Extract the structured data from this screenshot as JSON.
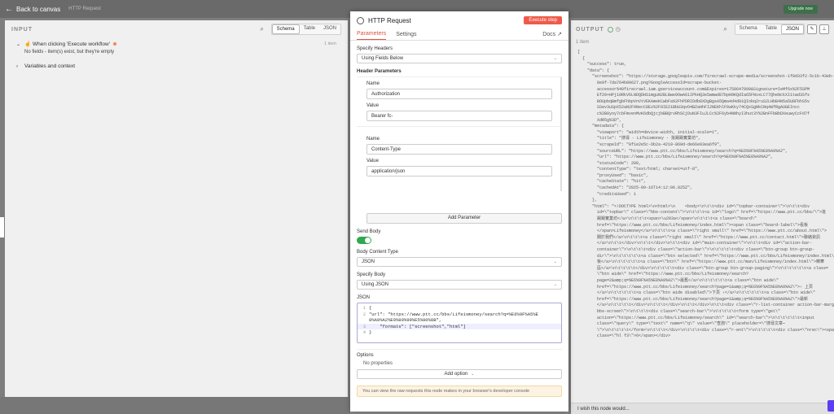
{
  "topbar": {
    "back_label": "Back to canvas",
    "ghost_title": "HTTP Request",
    "upgrade": "Upgrade now"
  },
  "input_panel": {
    "title": "INPUT",
    "views": [
      "Schema",
      "Table",
      "JSON"
    ],
    "active_view": "Schema",
    "trigger_label": "When clicking 'Execute workflow'",
    "item_count": "1 item",
    "empty_text": "No fields - item(s) exist, but they're empty",
    "variables_label": "Variables and context"
  },
  "node": {
    "title": "HTTP Request",
    "execute_label": "Execute step",
    "tabs": [
      "Parameters",
      "Settings"
    ],
    "docs_label": "Docs",
    "specify_headers_label": "Specify Headers",
    "specify_headers_value": "Using Fields Below",
    "header_params_label": "Header Parameters",
    "headers": [
      {
        "name_label": "Name",
        "name_value": "Authorization",
        "value_label": "Value",
        "value_value": "Bearer fc-"
      },
      {
        "name_label": "Name",
        "name_value": "Content-Type",
        "value_label": "Value",
        "value_value": "application/json"
      }
    ],
    "add_param_label": "Add Parameter",
    "send_body_label": "Send Body",
    "send_body_on": true,
    "body_content_type_label": "Body Content Type",
    "body_content_type_value": "JSON",
    "specify_body_label": "Specify Body",
    "specify_body_value": "Using JSON",
    "json_label": "JSON",
    "json_lines": [
      {
        "n": "1",
        "text": "{"
      },
      {
        "n": "2",
        "text": "    \"url\": \"https://www.ptt.cc/bbs/Lifeismoney/search?q=%E6%9F%A5%E8%A9%A2%E9%80%99%E5%80%8B\","
      },
      {
        "n": "3",
        "text": "    \"formats\": [\"screenshot\",\"html\"]"
      },
      {
        "n": "4",
        "text": "}"
      }
    ],
    "options_label": "Options",
    "no_properties": "No properties",
    "add_option_label": "Add option",
    "hint": "You can view the raw requests this node makes in your browser's developer console"
  },
  "output_panel": {
    "title": "OUTPUT",
    "views": [
      "Schema",
      "Table",
      "JSON"
    ],
    "active_view": "JSON",
    "item_count": "1 item",
    "wish_label": "I wish this node would...",
    "json_lines": [
      "[",
      "  {",
      "    \"success\": true,",
      "    \"data\": {",
      "      \"screenshot\": \"https://storage.googleapis.com/firecrawl-scrape-media/screenshot-1f8d33f2-5c1b-43eb-",
      "        8e9f-7da764b00627.png?GoogleAccessId=scrape-bucket-",
      "        accessor%40firecrawl.iam.gserviceaccount.com&Expires=1758647099&Signature=IeMf6x%2F5SPM",
      "        Ef29+HPj10RkV6LNDQDHSimguN2BLBwe9OwA61IPkHQ3e5wmwd87bpH9KQdIa65FNvsLC77QheNckXI1twd3Sfs",
      "        BOUpbqBmfgbFhbpVnVtVEKAmeKCwbFa%2FhPDRIDdb8XDgBgsA5Qma4d4d01QIobq2ruS2LHbB4N5a5U8FbhS5v",
      "        SSev3uSpX52aN2F9NecC8Ez%2F0IE21BbU3qvO4BZaHhFI2NEKhlF0aKky74CQxSgNkCNq4WfRgAUGEIncc",
      "        c%2B0yoy7cbFmvenMvK6dbQjcjbBBQrvRhSCjDuN3FIuJLCc%2F6yb4NNhyI3hut3Y%2BnFFbBbDXeuwyCcFd7f",
      "        XdR5g%3D\",",
      "      \"metadata\": {",
      "        \"viewport\": \"width=device-width, initial-scale=1\",",
      "        \"title\": \"搜尋 - Lifeismoney - 批踢踢實業坊\",",
      "        \"scrapeId\": \"0f1e2e5c-6b2a-4219-869d-de66e03ea6f9\",",
      "        \"sourceURL\": \"https://www.ptt.cc/bbs/Lifeismoney/search?q=%E6%9F%A5%E8%A9%A2\",",
      "        \"url\": \"https://www.ptt.cc/bbs/Lifeismoney/search?q=%E6%9F%A5%E8%A9%A2\",",
      "        \"statusCode\": 200,",
      "        \"contentType\": \"text/html; charset=utf-8\",",
      "        \"proxyUsed\": \"basic\",",
      "        \"cacheState\": \"hit\",",
      "        \"cachedAt\": \"2025-09-16T14:12:06.825Z\",",
      "        \"creditsUsed\": 1",
      "      },",
      "      \"html\": \"<!DOCTYPE html>\\n<html>\\n    <body>\\n\\t\\t<div id=\\\"topbar-container\\\">\\n\\t\\t<div",
      "        id=\\\"topbar\\\" class=\\\"bbs-content\\\">\\n\\t\\t\\t<a id=\\\"logo\\\" href=\\\"https://www.ptt.cc/bbs/\\\">批",
      "        踢踢實業坊</a>\\n\\t\\t\\t<span>\\u203a</span>\\n\\t\\t\\t<a class=\\\"board\\\"",
      "        href=\\\"https://www.ptt.cc/bbs/Lifeismoney/index.html\\\"><span class=\\\"board-label\\\">看板",
      "        </span>Lifeismoney</a>\\n\\t\\t\\t<a class=\\\"right small\\\" href=\\\"https://www.ptt.cc/about.html\\\">",
      "        關於我們</a>\\n\\t\\t\\t<a class=\\\"right small\\\" href=\\\"https://www.ptt.cc/contact.html\\\">聯絡資訊",
      "        </a>\\n\\t\\t</div>\\n\\t\\t</div>\\n\\t\\t<div id=\\\"main-container\\\">\\n\\t\\t<div id=\\\"action-bar-",
      "        container\\\">\\n\\t\\t\\t<div class=\\\"action-bar\\\">\\n\\t\\t\\t\\t<div class=\\\"btn-group btn-group-",
      "        dir\\\">\\n\\t\\t\\t\\t\\t<a class=\\\"btn selected\\\" href=\\\"https://www.ptt.cc/bbs/Lifeismoney/index.html\\\">看",
      "        板</a>\\n\\t\\t\\t\\t\\t<a class=\\\"btn\\\" href=\\\"https://www.ptt.cc/man/Lifeismoney/index.html\\\">精華",
      "        區</a>\\n\\t\\t\\t\\t</div>\\n\\t\\t\\t\\t<div class=\\\"btn-group btn-group-paging\\\">\\n\\t\\t\\t\\t\\t<a class=",
      "        \\\"btn wide\\\" href=\\\"https://www.ptt.cc/bbs/Lifeismoney/search?",
      "        page=2&amp;q=%E6%9F%A5%E8%A9%A2\\\">最舊</a>\\n\\t\\t\\t\\t\\t<a class=\\\"btn wide\\\"",
      "        href=\\\"https://www.ptt.cc/bbs/Lifeismoney/search?page=1&amp;q=%E6%9F%A5%E8%A9%A2\\\">‹ 上頁",
      "        </a>\\n\\t\\t\\t\\t\\t<a class=\\\"btn wide disabled\\\">下頁 ›</a>\\n\\t\\t\\t\\t\\t<a class=\\\"btn wide\\\"",
      "        href=\\\"https://www.ptt.cc/bbs/Lifeismoney/search?page=1&amp;q=%E6%9F%A5%E8%A9%A2\\\">最新",
      "        </a>\\n\\t\\t\\t\\t</div>\\n\\t\\t\\t</div>\\n\\t\\t</div>\\n\\t\\t<div class=\\\"r-list-container action-bar-margin",
      "        bbs-screen\\\">\\n\\t\\t\\t<div class=\\\"search-bar\\\">\\n\\t\\t\\t\\t<form type=\\\"get\\\"",
      "        action=\\\"https://www.ptt.cc/bbs/Lifeismoney/search\\\" id=\\\"search-bar\\\">\\n\\t\\t\\t\\t\\t<input",
      "        class=\\\"query\\\" type=\\\"text\\\" name=\\\"q\\\" value=\\\"查詢\\\" placeholder=\\\"搜尋文章⋯",
      "        \\\">\\n\\t\\t\\t\\t</form>\\n\\t\\t\\t</div>\\n\\t\\t\\t<div class=\\\"r-ent\\\">\\n\\t\\t\\t\\t<div class=\\\"nrec\\\"><span",
      "        class=\\\"hl f3\\\">6</span></div>"
    ]
  }
}
